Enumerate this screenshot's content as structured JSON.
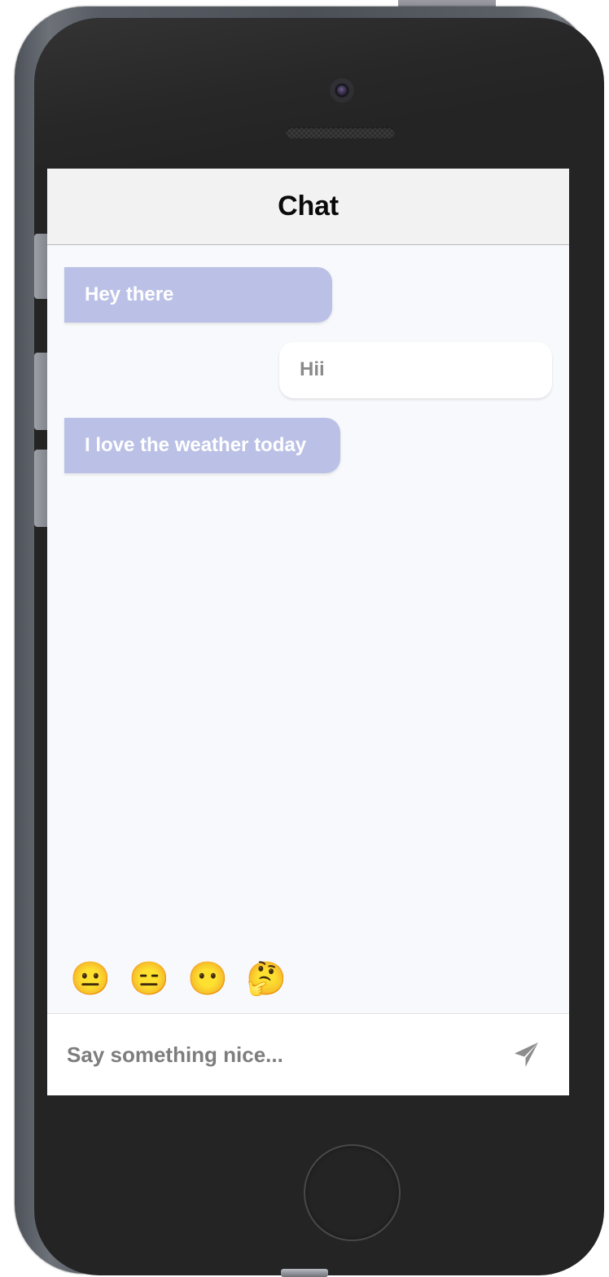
{
  "device": {
    "type": "smartphone-mockup",
    "frame_color": "#242424",
    "rim_color": "#5b5f66",
    "hardware": {
      "camera": "front-camera",
      "speaker": "earpiece-speaker",
      "home_button": "home-button",
      "power_button": "power-button",
      "mute_switch": "mute-switch",
      "volume_up": "volume-up-button",
      "volume_down": "volume-down-button",
      "charging_port": "charging-port"
    }
  },
  "app": {
    "header": {
      "title": "Chat"
    },
    "colors": {
      "sender_bubble": "#bbc1e6",
      "sender_text": "#ffffff",
      "receiver_bubble": "#ffffff",
      "receiver_text": "#8a8a8a",
      "header_bg": "#f2f2f2",
      "chat_bg": "#f8f9fc",
      "placeholder_text": "#7d7d7d",
      "send_icon": "#8c8c8c"
    },
    "messages": [
      {
        "text": "Hey there",
        "side": "left",
        "author": "sender"
      },
      {
        "text": "Hii",
        "side": "right",
        "author": "receiver"
      },
      {
        "text": "I love the weather today",
        "side": "left",
        "author": "sender"
      }
    ],
    "emoji_bar": [
      {
        "glyph": "😐",
        "name": "neutral-face"
      },
      {
        "glyph": "😑",
        "name": "expressionless-face"
      },
      {
        "glyph": "😶",
        "name": "face-without-mouth"
      },
      {
        "glyph": "🤔",
        "name": "thinking-face"
      }
    ],
    "composer": {
      "placeholder": "Say something nice...",
      "value": "",
      "send_icon": "send-paper-plane-icon"
    }
  }
}
